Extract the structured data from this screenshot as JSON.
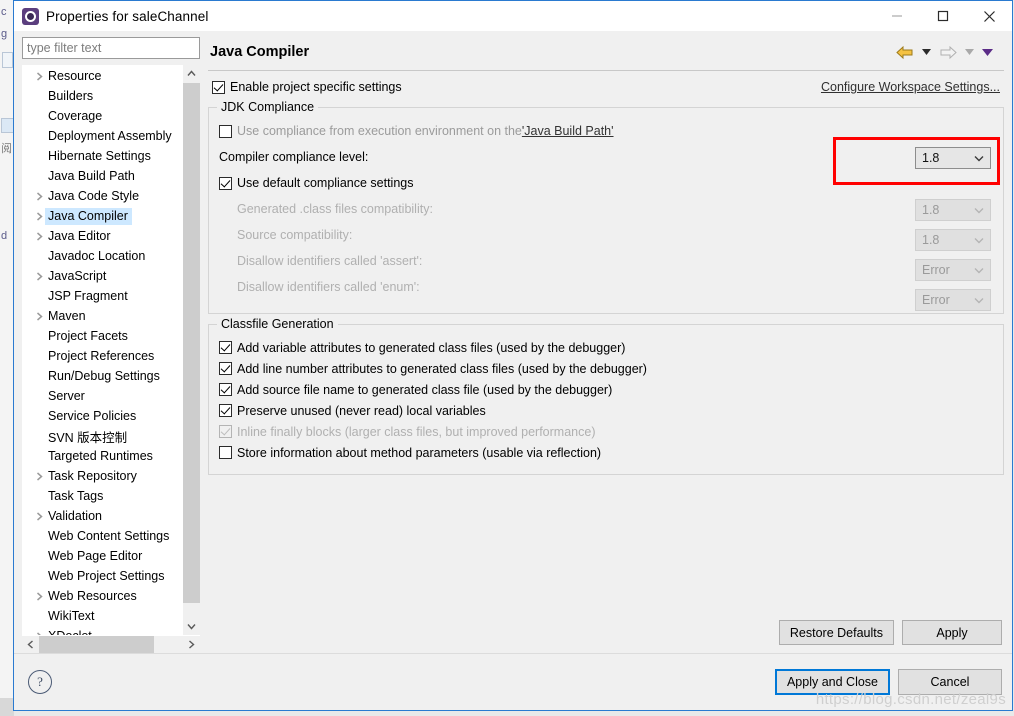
{
  "window": {
    "title": "Properties for saleChannel",
    "icon": "eclipse-properties-icon",
    "minimize": "—",
    "maximize": "☐",
    "close": "✕"
  },
  "sidebar": {
    "filter_placeholder": "type filter text",
    "filter_value": "",
    "items": [
      {
        "label": "Resource",
        "expandable": true,
        "selected": false
      },
      {
        "label": "Builders",
        "expandable": false,
        "selected": false
      },
      {
        "label": "Coverage",
        "expandable": false,
        "selected": false
      },
      {
        "label": "Deployment Assembly",
        "expandable": false,
        "selected": false
      },
      {
        "label": "Hibernate Settings",
        "expandable": false,
        "selected": false
      },
      {
        "label": "Java Build Path",
        "expandable": false,
        "selected": false
      },
      {
        "label": "Java Code Style",
        "expandable": true,
        "selected": false
      },
      {
        "label": "Java Compiler",
        "expandable": true,
        "selected": true
      },
      {
        "label": "Java Editor",
        "expandable": true,
        "selected": false
      },
      {
        "label": "Javadoc Location",
        "expandable": false,
        "selected": false
      },
      {
        "label": "JavaScript",
        "expandable": true,
        "selected": false
      },
      {
        "label": "JSP Fragment",
        "expandable": false,
        "selected": false
      },
      {
        "label": "Maven",
        "expandable": true,
        "selected": false
      },
      {
        "label": "Project Facets",
        "expandable": false,
        "selected": false
      },
      {
        "label": "Project References",
        "expandable": false,
        "selected": false
      },
      {
        "label": "Run/Debug Settings",
        "expandable": false,
        "selected": false
      },
      {
        "label": "Server",
        "expandable": false,
        "selected": false
      },
      {
        "label": "Service Policies",
        "expandable": false,
        "selected": false
      },
      {
        "label": "SVN 版本控制",
        "expandable": false,
        "selected": false
      },
      {
        "label": "Targeted Runtimes",
        "expandable": false,
        "selected": false
      },
      {
        "label": "Task Repository",
        "expandable": true,
        "selected": false
      },
      {
        "label": "Task Tags",
        "expandable": false,
        "selected": false
      },
      {
        "label": "Validation",
        "expandable": true,
        "selected": false
      },
      {
        "label": "Web Content Settings",
        "expandable": false,
        "selected": false
      },
      {
        "label": "Web Page Editor",
        "expandable": false,
        "selected": false
      },
      {
        "label": "Web Project Settings",
        "expandable": false,
        "selected": false
      },
      {
        "label": "Web Resources",
        "expandable": true,
        "selected": false
      },
      {
        "label": "WikiText",
        "expandable": false,
        "selected": false
      },
      {
        "label": "XDoclet",
        "expandable": true,
        "selected": false
      }
    ]
  },
  "page": {
    "title": "Java Compiler",
    "nav_back_icon": "back-arrow-icon",
    "nav_back_menu_icon": "chevron-down-icon",
    "nav_forward_icon": "forward-arrow-icon",
    "nav_forward_menu_icon": "chevron-down-icon",
    "nav_view_menu_icon": "chevron-down-icon",
    "enable_project_specific": {
      "label": "Enable project specific settings",
      "checked": true
    },
    "configure_workspace_link": "Configure Workspace Settings...",
    "jdk_compliance": {
      "group_title": "JDK Compliance",
      "use_execution_env": {
        "label_prefix": "Use compliance from execution environment on the ",
        "label_link": "'Java Build Path'",
        "checked": false
      },
      "compiler_compliance_level": {
        "label": "Compiler compliance level:",
        "value": "1.8",
        "enabled": true,
        "highlighted": true
      },
      "use_default_compliance": {
        "label": "Use default compliance settings",
        "checked": true
      },
      "generated_class_compat": {
        "label": "Generated .class files compatibility:",
        "value": "1.8",
        "enabled": false
      },
      "source_compat": {
        "label": "Source compatibility:",
        "value": "1.8",
        "enabled": false
      },
      "disallow_assert": {
        "label": "Disallow identifiers called 'assert':",
        "value": "Error",
        "enabled": false
      },
      "disallow_enum": {
        "label": "Disallow identifiers called 'enum':",
        "value": "Error",
        "enabled": false
      }
    },
    "classfile_generation": {
      "group_title": "Classfile Generation",
      "options": [
        {
          "label": "Add variable attributes to generated class files (used by the debugger)",
          "checked": true,
          "enabled": true
        },
        {
          "label": "Add line number attributes to generated class files (used by the debugger)",
          "checked": true,
          "enabled": true
        },
        {
          "label": "Add source file name to generated class file (used by the debugger)",
          "checked": true,
          "enabled": true
        },
        {
          "label": "Preserve unused (never read) local variables",
          "checked": true,
          "enabled": true
        },
        {
          "label": "Inline finally blocks (larger class files, but improved performance)",
          "checked": true,
          "enabled": false
        },
        {
          "label": "Store information about method parameters (usable via reflection)",
          "checked": false,
          "enabled": true
        }
      ]
    },
    "restore_defaults_label": "Restore Defaults",
    "apply_label": "Apply"
  },
  "footer": {
    "help_icon": "question-mark-icon",
    "help_glyph": "?",
    "apply_and_close_label": "Apply and Close",
    "cancel_label": "Cancel",
    "watermark": "https://blog.csdn.net/zeal9s"
  },
  "colors": {
    "accent": "#0078d7",
    "highlight_box": "#ff0000",
    "selection": "#cde8ff",
    "dialog_bg": "#f0f0f0"
  }
}
